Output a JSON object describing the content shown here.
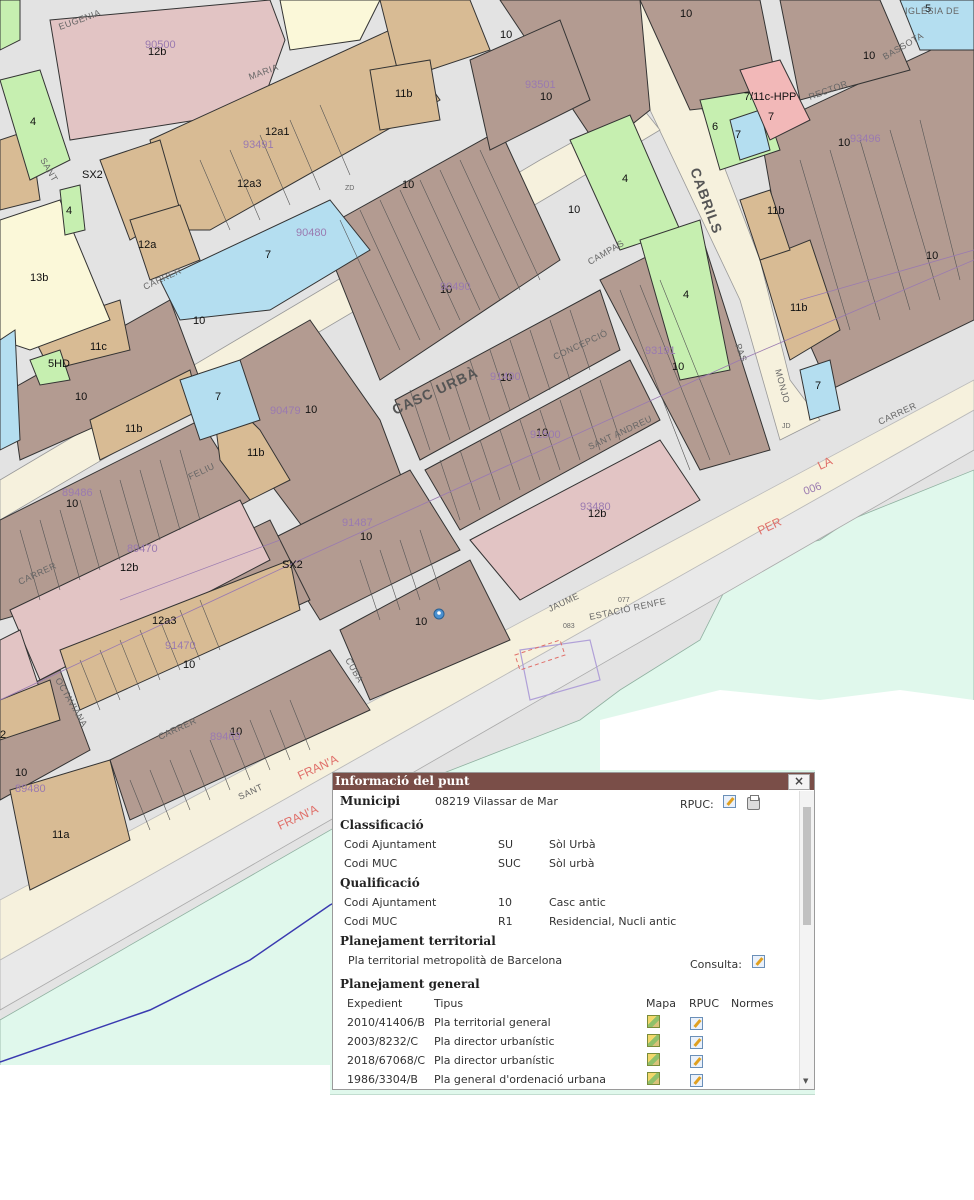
{
  "map": {
    "zone_codes": [
      "4",
      "12b",
      "11b",
      "10",
      "12a1",
      "12a3",
      "12a",
      "13b",
      "SX2",
      "7",
      "11c",
      "5HD",
      "ZD",
      "JD",
      "7/11c-HPP",
      "6",
      "5",
      "10",
      "11a",
      "12b",
      "12a3",
      "2",
      "10"
    ],
    "parcel_codes": [
      "90500",
      "93501",
      "93491",
      "90490",
      "91490",
      "91500",
      "90480",
      "89486",
      "89470",
      "91487",
      "90479",
      "91470",
      "93480",
      "89480",
      "89469",
      "93496",
      "93191"
    ],
    "street_labels": [
      "EUGENIA",
      "MARIA",
      "SANT",
      "CARRER",
      "CAMPAS",
      "CASC URBÀ",
      "CONCEPCIÓ",
      "SANT ANDREU",
      "FELIU",
      "CUBA",
      "OCTAVIANA",
      "JAUME",
      "ESTACIÓ RENFE",
      "PAS",
      "MONJO",
      "RECTOR",
      "BASSOTA",
      "IGLÉSIA DE"
    ],
    "big_labels": [
      "CABRILS",
      "CASC URBÀ"
    ],
    "rail_labels": [
      "FRAN'A",
      "FRAN'A",
      "PER",
      "LA",
      "006",
      "077",
      "083"
    ],
    "colors": {
      "residential_brown": "#b39b91",
      "old_town_pink": "#e2c4c4",
      "tan": "#d8bb94",
      "green": "#c6efb0",
      "blue": "#b4def0",
      "coast": "#e0f8ec",
      "street": "#e3e3e3",
      "road": "#f6f1dd",
      "panel_header": "#7a4e48"
    }
  },
  "panel": {
    "title": "Informació del punt",
    "close": "×",
    "municipi_label": "Municipi",
    "municipi_value": "08219 Vilassar de Mar",
    "rpuc_label": "RPUC:",
    "classificacio": {
      "title": "Classificació",
      "rows": [
        {
          "label": "Codi Ajuntament",
          "code": "SU",
          "desc": "Sòl Urbà"
        },
        {
          "label": "Codi MUC",
          "code": "SUC",
          "desc": "Sòl urbà"
        }
      ]
    },
    "qualificacio": {
      "title": "Qualificació",
      "rows": [
        {
          "label": "Codi Ajuntament",
          "code": "10",
          "desc": "Casc antic"
        },
        {
          "label": "Codi MUC",
          "code": "R1",
          "desc": "Residencial, Nucli antic"
        }
      ]
    },
    "territorial": {
      "title": "Planejament territorial",
      "plan": "Pla territorial metropolità de Barcelona",
      "consulta_label": "Consulta:"
    },
    "general": {
      "title": "Planejament general",
      "columns": {
        "expedient": "Expedient",
        "tipus": "Tipus",
        "mapa": "Mapa",
        "rpuc": "RPUC",
        "normes": "Normes"
      },
      "rows": [
        {
          "expedient": "2010/41406/B",
          "tipus": "Pla territorial general"
        },
        {
          "expedient": "2003/8232/C",
          "tipus": "Pla director urbanístic"
        },
        {
          "expedient": "2018/67068/C",
          "tipus": "Pla director urbanístic"
        },
        {
          "expedient": "1986/3304/B",
          "tipus": "Pla general d'ordenació urbana"
        }
      ]
    }
  }
}
